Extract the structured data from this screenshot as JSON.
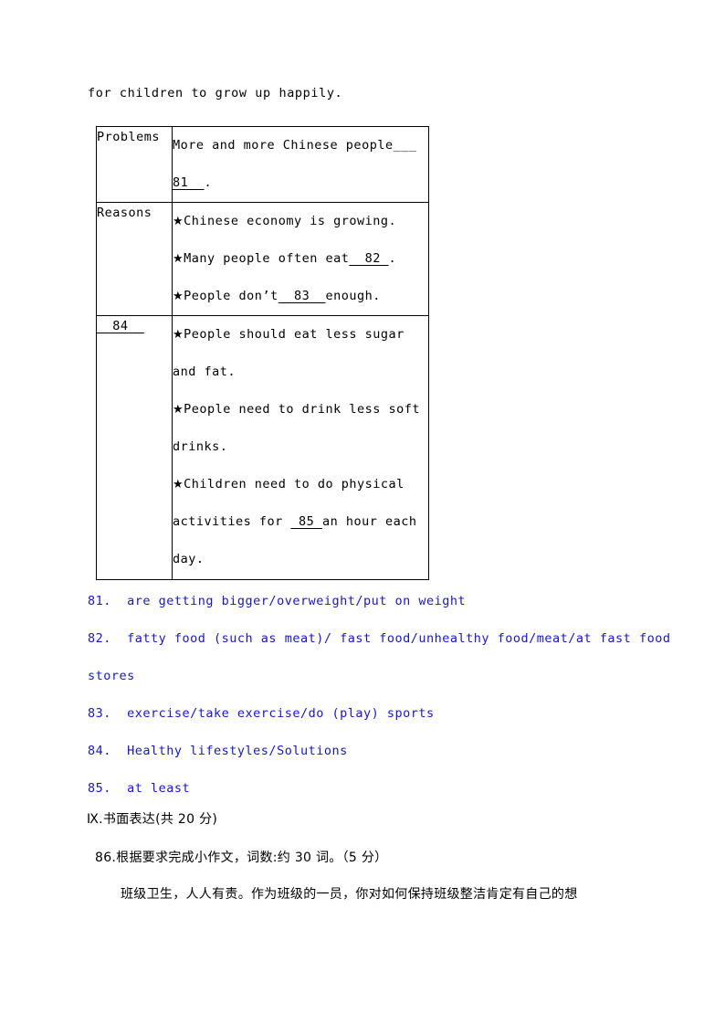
{
  "document": {
    "intro_line": "for children to grow up happily."
  },
  "table": {
    "rows": [
      {
        "label": "Problems",
        "label_is_blank": false,
        "lines": [
          {
            "bullet": "",
            "segments": [
              {
                "text": "More and more Chinese people",
                "blank": false
              },
              {
                "text": "___",
                "blank": false
              }
            ]
          },
          {
            "bullet": "",
            "segments": [
              {
                "text": "81  ",
                "blank": true
              },
              {
                "text": ".",
                "blank": false
              }
            ]
          }
        ]
      },
      {
        "label": "Reasons",
        "label_is_blank": false,
        "lines": [
          {
            "bullet": "★",
            "segments": [
              {
                "text": "Chinese economy is growing.",
                "blank": false
              }
            ]
          },
          {
            "bullet": "★",
            "segments": [
              {
                "text": "Many people often eat",
                "blank": false
              },
              {
                "text": "  82 ",
                "blank": true
              },
              {
                "text": ".",
                "blank": false
              }
            ]
          },
          {
            "bullet": "★",
            "segments": [
              {
                "text": "People don’t",
                "blank": false
              },
              {
                "text": "  83  ",
                "blank": true
              },
              {
                "text": "enough.",
                "blank": false
              }
            ]
          }
        ]
      },
      {
        "label": "  84  ",
        "label_is_blank": true,
        "lines": [
          {
            "bullet": "★",
            "segments": [
              {
                "text": "People should eat less sugar",
                "blank": false
              }
            ]
          },
          {
            "bullet": "",
            "segments": [
              {
                "text": "and fat.",
                "blank": false
              }
            ]
          },
          {
            "bullet": "★",
            "segments": [
              {
                "text": "People need to drink less soft",
                "blank": false
              }
            ]
          },
          {
            "bullet": "",
            "segments": [
              {
                "text": "drinks.",
                "blank": false
              }
            ]
          },
          {
            "bullet": "★",
            "segments": [
              {
                "text": "Children need to do physical",
                "blank": false
              }
            ]
          },
          {
            "bullet": "",
            "segments": [
              {
                "text": "activities for ",
                "blank": false
              },
              {
                "text": " 85 ",
                "blank": true
              },
              {
                "text": "an hour each",
                "blank": false
              }
            ]
          },
          {
            "bullet": "",
            "segments": [
              {
                "text": "day.",
                "blank": false
              }
            ]
          }
        ]
      }
    ]
  },
  "answer_key": {
    "color": "#1717C4",
    "items": [
      "81.  are getting bigger/overweight/put on weight",
      "82.  fatty food (such as meat)/ fast food/unhealthy food/meat/at fast food stores",
      "83.  exercise/take exercise/do (play) sports",
      "84.  Healthy lifestyles/Solutions",
      "85.  at least"
    ]
  },
  "writing_section": {
    "heading": "Ⅸ.书面表达(共 20 分)",
    "question_86": "86.根据要求完成小作文，词数:约 30 词。（5 分）",
    "question_86_body": "班级卫生，人人有责。作为班级的一员，你对如何保持班级整洁肯定有自己的想"
  }
}
